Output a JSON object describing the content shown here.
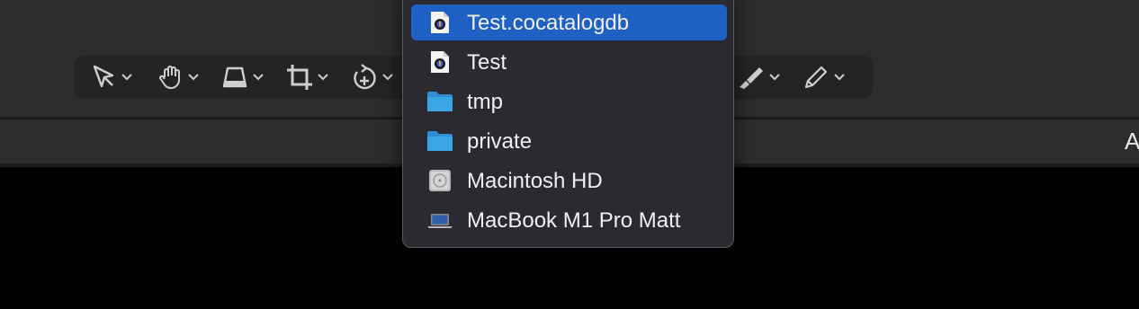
{
  "toolbar": {
    "tools": [
      {
        "name": "select-tool",
        "icon": "cursor-arrow-icon"
      },
      {
        "name": "pan-tool",
        "icon": "hand-icon"
      },
      {
        "name": "perspective-tool",
        "icon": "keystone-icon"
      },
      {
        "name": "crop-tool",
        "icon": "crop-icon"
      },
      {
        "name": "rotate-tool",
        "icon": "rotate-plus-icon"
      },
      {
        "name": "brush-tool",
        "icon": "brush-icon"
      },
      {
        "name": "pen-tool",
        "icon": "pencil-icon"
      }
    ]
  },
  "subbar": {
    "trailing_text": "A"
  },
  "menu": {
    "items": [
      {
        "label": "Test.cocatalogdb",
        "icon": "catalog-file-icon",
        "selected": true
      },
      {
        "label": "Test",
        "icon": "catalog-file-icon",
        "selected": false
      },
      {
        "label": "tmp",
        "icon": "folder-icon",
        "selected": false
      },
      {
        "label": "private",
        "icon": "folder-icon",
        "selected": false
      },
      {
        "label": "Macintosh HD",
        "icon": "hard-drive-icon",
        "selected": false
      },
      {
        "label": "MacBook M1 Pro Matt",
        "icon": "laptop-icon",
        "selected": false
      }
    ]
  },
  "colors": {
    "accent": "#1f60c4",
    "menu_bg": "#2b2a31",
    "folder": "#3aa6e6"
  }
}
